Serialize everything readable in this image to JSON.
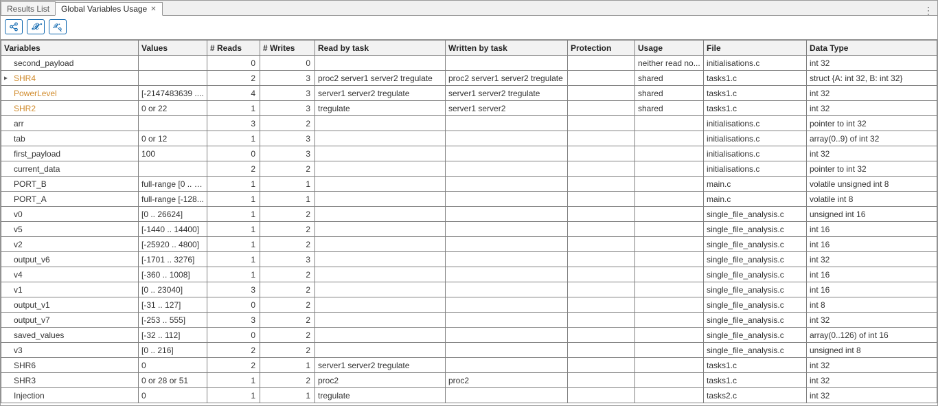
{
  "tabs": {
    "results_list": "Results List",
    "active": "Global Variables Usage"
  },
  "toolbar": {
    "share_tip": "Share",
    "var_tip": "Variable",
    "var_tool_tip": "Variable settings"
  },
  "columns": {
    "variables": "Variables",
    "values": "Values",
    "reads": "# Reads",
    "writes": "# Writes",
    "readby": "Read by task",
    "writby": "Written by task",
    "prot": "Protection",
    "usage": "Usage",
    "file": "File",
    "dtype": "Data Type"
  },
  "rows": [
    {
      "var": "second_payload",
      "val": "",
      "reads": "0",
      "writes": "0",
      "readby": "",
      "writby": "",
      "prot": "",
      "usage": "neither read no...",
      "file": "initialisations.c",
      "dtype": "int 32",
      "orange": false,
      "expand": false
    },
    {
      "var": "SHR4",
      "val": "",
      "reads": "2",
      "writes": "3",
      "readby": "proc2 server1 server2 tregulate",
      "writby": "proc2 server1 server2 tregulate",
      "prot": "",
      "usage": "shared",
      "file": "tasks1.c",
      "dtype": "struct {A: int 32, B: int 32}",
      "orange": true,
      "expand": true
    },
    {
      "var": "PowerLevel",
      "val": "[-2147483639 ....",
      "reads": "4",
      "writes": "3",
      "readby": "server1 server2 tregulate",
      "writby": "server1 server2 tregulate",
      "prot": "",
      "usage": "shared",
      "file": "tasks1.c",
      "dtype": "int 32",
      "orange": true,
      "expand": false
    },
    {
      "var": "SHR2",
      "val": "0 or 22",
      "reads": "1",
      "writes": "3",
      "readby": "tregulate",
      "writby": "server1 server2",
      "prot": "",
      "usage": "shared",
      "file": "tasks1.c",
      "dtype": "int 32",
      "orange": true,
      "expand": false
    },
    {
      "var": "arr",
      "val": "",
      "reads": "3",
      "writes": "2",
      "readby": "",
      "writby": "",
      "prot": "",
      "usage": "",
      "file": "initialisations.c",
      "dtype": "pointer to int 32",
      "orange": false,
      "expand": false
    },
    {
      "var": "tab",
      "val": "0 or 12",
      "reads": "1",
      "writes": "3",
      "readby": "",
      "writby": "",
      "prot": "",
      "usage": "",
      "file": "initialisations.c",
      "dtype": "array(0..9) of int 32",
      "orange": false,
      "expand": false
    },
    {
      "var": "first_payload",
      "val": "100",
      "reads": "0",
      "writes": "3",
      "readby": "",
      "writby": "",
      "prot": "",
      "usage": "",
      "file": "initialisations.c",
      "dtype": "int 32",
      "orange": false,
      "expand": false
    },
    {
      "var": "current_data",
      "val": "",
      "reads": "2",
      "writes": "2",
      "readby": "",
      "writby": "",
      "prot": "",
      "usage": "",
      "file": "initialisations.c",
      "dtype": "pointer to int 32",
      "orange": false,
      "expand": false
    },
    {
      "var": "PORT_B",
      "val": "full-range [0 .. 2...",
      "reads": "1",
      "writes": "1",
      "readby": "",
      "writby": "",
      "prot": "",
      "usage": "",
      "file": "main.c",
      "dtype": "volatile unsigned int 8",
      "orange": false,
      "expand": false
    },
    {
      "var": "PORT_A",
      "val": "full-range [-128...",
      "reads": "1",
      "writes": "1",
      "readby": "",
      "writby": "",
      "prot": "",
      "usage": "",
      "file": "main.c",
      "dtype": "volatile int 8",
      "orange": false,
      "expand": false
    },
    {
      "var": "v0",
      "val": "[0 .. 26624]",
      "reads": "1",
      "writes": "2",
      "readby": "",
      "writby": "",
      "prot": "",
      "usage": "",
      "file": "single_file_analysis.c",
      "dtype": "unsigned int 16",
      "orange": false,
      "expand": false
    },
    {
      "var": "v5",
      "val": "[-1440 .. 14400]",
      "reads": "1",
      "writes": "2",
      "readby": "",
      "writby": "",
      "prot": "",
      "usage": "",
      "file": "single_file_analysis.c",
      "dtype": "int 16",
      "orange": false,
      "expand": false
    },
    {
      "var": "v2",
      "val": "[-25920 .. 4800]",
      "reads": "1",
      "writes": "2",
      "readby": "",
      "writby": "",
      "prot": "",
      "usage": "",
      "file": "single_file_analysis.c",
      "dtype": "int 16",
      "orange": false,
      "expand": false
    },
    {
      "var": "output_v6",
      "val": "[-1701 .. 3276]",
      "reads": "1",
      "writes": "3",
      "readby": "",
      "writby": "",
      "prot": "",
      "usage": "",
      "file": "single_file_analysis.c",
      "dtype": "int 32",
      "orange": false,
      "expand": false
    },
    {
      "var": "v4",
      "val": "[-360 .. 1008]",
      "reads": "1",
      "writes": "2",
      "readby": "",
      "writby": "",
      "prot": "",
      "usage": "",
      "file": "single_file_analysis.c",
      "dtype": "int 16",
      "orange": false,
      "expand": false
    },
    {
      "var": "v1",
      "val": "[0 .. 23040]",
      "reads": "3",
      "writes": "2",
      "readby": "",
      "writby": "",
      "prot": "",
      "usage": "",
      "file": "single_file_analysis.c",
      "dtype": "int 16",
      "orange": false,
      "expand": false
    },
    {
      "var": "output_v1",
      "val": "[-31 .. 127]",
      "reads": "0",
      "writes": "2",
      "readby": "",
      "writby": "",
      "prot": "",
      "usage": "",
      "file": "single_file_analysis.c",
      "dtype": "int 8",
      "orange": false,
      "expand": false
    },
    {
      "var": "output_v7",
      "val": "[-253 .. 555]",
      "reads": "3",
      "writes": "2",
      "readby": "",
      "writby": "",
      "prot": "",
      "usage": "",
      "file": "single_file_analysis.c",
      "dtype": "int 32",
      "orange": false,
      "expand": false
    },
    {
      "var": "saved_values",
      "val": "[-32 .. 112]",
      "reads": "0",
      "writes": "2",
      "readby": "",
      "writby": "",
      "prot": "",
      "usage": "",
      "file": "single_file_analysis.c",
      "dtype": "array(0..126) of int 16",
      "orange": false,
      "expand": false
    },
    {
      "var": "v3",
      "val": "[0 .. 216]",
      "reads": "2",
      "writes": "2",
      "readby": "",
      "writby": "",
      "prot": "",
      "usage": "",
      "file": "single_file_analysis.c",
      "dtype": "unsigned int 8",
      "orange": false,
      "expand": false
    },
    {
      "var": "SHR6",
      "val": "0",
      "reads": "2",
      "writes": "1",
      "readby": "server1 server2 tregulate",
      "writby": "",
      "prot": "",
      "usage": "",
      "file": "tasks1.c",
      "dtype": "int 32",
      "orange": false,
      "expand": false
    },
    {
      "var": "SHR3",
      "val": "0 or 28 or 51",
      "reads": "1",
      "writes": "2",
      "readby": "proc2",
      "writby": "proc2",
      "prot": "",
      "usage": "",
      "file": "tasks1.c",
      "dtype": "int 32",
      "orange": false,
      "expand": false
    },
    {
      "var": "Injection",
      "val": "0",
      "reads": "1",
      "writes": "1",
      "readby": "tregulate",
      "writby": "",
      "prot": "",
      "usage": "",
      "file": "tasks2.c",
      "dtype": "int 32",
      "orange": false,
      "expand": false
    }
  ]
}
